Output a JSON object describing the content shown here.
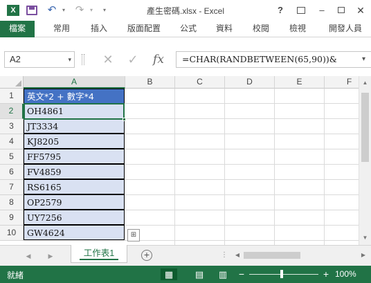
{
  "window": {
    "title": "產生密碼.xlsx - Excel",
    "logo_text": "X",
    "help": "?",
    "minimize": "–",
    "close": "✕"
  },
  "quick_access": {
    "undo_glyph": "↶",
    "redo_glyph": "↷",
    "dropdown_glyph": "▾",
    "customize_glyph": "▾"
  },
  "ribbon": {
    "tabs": [
      {
        "label": "檔案"
      },
      {
        "label": "常用"
      },
      {
        "label": "插入"
      },
      {
        "label": "版面配置"
      },
      {
        "label": "公式"
      },
      {
        "label": "資料"
      },
      {
        "label": "校閱"
      },
      {
        "label": "檢視"
      },
      {
        "label": "開發人員"
      }
    ]
  },
  "formula_bar": {
    "name_box": "A2",
    "name_dropdown": "▾",
    "cancel_glyph": "✕",
    "enter_glyph": "✓",
    "fx_label": "fx",
    "formula": "=CHAR(RANDBETWEEN(65,90))&",
    "expand_glyph": "▾"
  },
  "grid": {
    "columns": [
      "A",
      "B",
      "C",
      "D",
      "E",
      "F"
    ],
    "selected_column": "A",
    "rows": [
      "1",
      "2",
      "3",
      "4",
      "5",
      "6",
      "7",
      "8",
      "9",
      "10"
    ],
    "selected_row": "2",
    "cells_a": [
      "英文*2 + 數字*4",
      "OH4861",
      "JT3334",
      "KJ8205",
      "FF5795",
      "FV4859",
      "RS6165",
      "OP2579",
      "UY7256",
      "GW4624"
    ],
    "paste_options_glyph": "⊞"
  },
  "sheets": {
    "prev_glyph": "◀",
    "next_glyph": "▶",
    "tabs": [
      {
        "label": "工作表1",
        "active": true
      }
    ],
    "add_glyph": "+",
    "more_glyph": "⋮",
    "scroll_left": "◀",
    "scroll_right": "▶"
  },
  "status": {
    "text": "就緒",
    "zoom_minus": "−",
    "zoom_plus": "+",
    "zoom_level": "100%",
    "zoom_percent_value": 100,
    "accent": "#217346",
    "table_header_fill": "#4472c4",
    "table_body_fill": "#d9e1f2"
  }
}
